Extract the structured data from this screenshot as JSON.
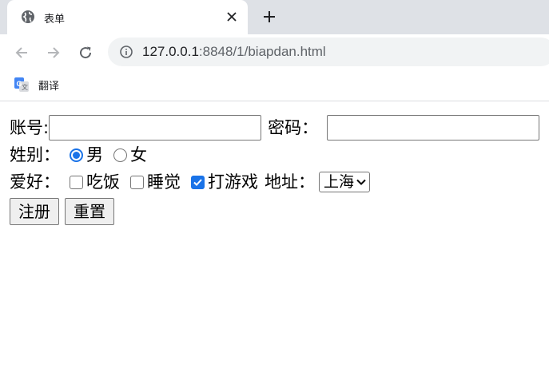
{
  "browser": {
    "tab": {
      "title": "表单"
    },
    "url": {
      "host": "127.0.0.1",
      "rest": ":8848/1/biapdan.html"
    },
    "bookmarks": [
      {
        "label": "翻译"
      }
    ]
  },
  "form": {
    "account_label": "账号:",
    "password_label": "密码：",
    "gender_label": "姓别：",
    "gender_options": [
      "男",
      "女"
    ],
    "gender_selected": "男",
    "hobby_label": "爱好：",
    "hobbies": [
      {
        "label": "吃饭",
        "checked": false
      },
      {
        "label": "睡觉",
        "checked": false
      },
      {
        "label": "打游戏",
        "checked": true
      }
    ],
    "address_label": "地址：",
    "address_value": "上海",
    "register_label": "注册",
    "reset_label": "重置"
  },
  "colors": {
    "accent": "#1a73e8",
    "tabstrip": "#dee1e6",
    "omnibox": "#f1f3f4"
  }
}
